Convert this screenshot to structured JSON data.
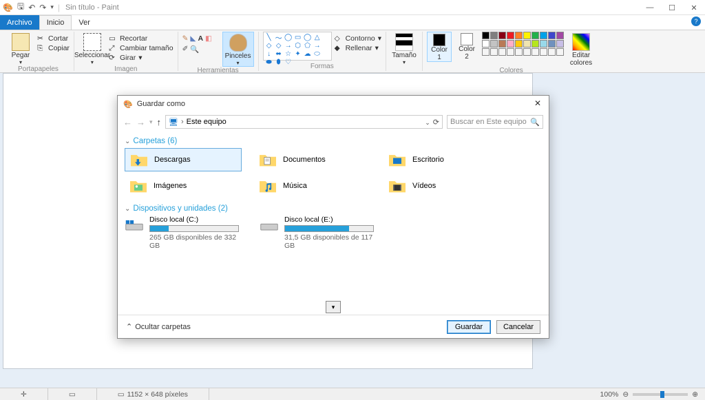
{
  "titlebar": {
    "app_title": "Sin título - Paint"
  },
  "tabs": {
    "file": "Archivo",
    "home": "Inicio",
    "view": "Ver"
  },
  "ribbon": {
    "clipboard": {
      "paste": "Pegar",
      "cut": "Cortar",
      "copy": "Copiar",
      "label": "Portapapeles"
    },
    "image": {
      "select": "Seleccionar",
      "crop": "Recortar",
      "resize": "Cambiar tamaño",
      "rotate": "Girar",
      "label": "Imagen"
    },
    "tools": {
      "brushes": "Pinceles",
      "label": "Herramientas"
    },
    "shapes": {
      "outline": "Contorno",
      "fill": "Rellenar",
      "label": "Formas"
    },
    "size": {
      "label": "Tamaño",
      "btn": "Tamaño"
    },
    "colors": {
      "color1": "Color\n1",
      "color2": "Color\n2",
      "edit": "Editar\ncolores",
      "label": "Colores"
    }
  },
  "statusbar": {
    "dims": "1152 × 648 píxeles",
    "zoom": "100%"
  },
  "dialog": {
    "title": "Guardar como",
    "location": "Este equipo",
    "search_placeholder": "Buscar en Este equipo",
    "folders_header": "Carpetas (6)",
    "folders": [
      {
        "name": "Descargas"
      },
      {
        "name": "Documentos"
      },
      {
        "name": "Escritorio"
      },
      {
        "name": "Imágenes"
      },
      {
        "name": "Música"
      },
      {
        "name": "Vídeos"
      }
    ],
    "drives_header": "Dispositivos y unidades (2)",
    "drives": [
      {
        "name": "Disco local (C:)",
        "sub": "265 GB disponibles de 332 GB",
        "fill_pct": 21
      },
      {
        "name": "Disco local (E:)",
        "sub": "31,5 GB disponibles de 117 GB",
        "fill_pct": 73
      }
    ],
    "hide_folders": "Ocultar carpetas",
    "save": "Guardar",
    "cancel": "Cancelar"
  }
}
